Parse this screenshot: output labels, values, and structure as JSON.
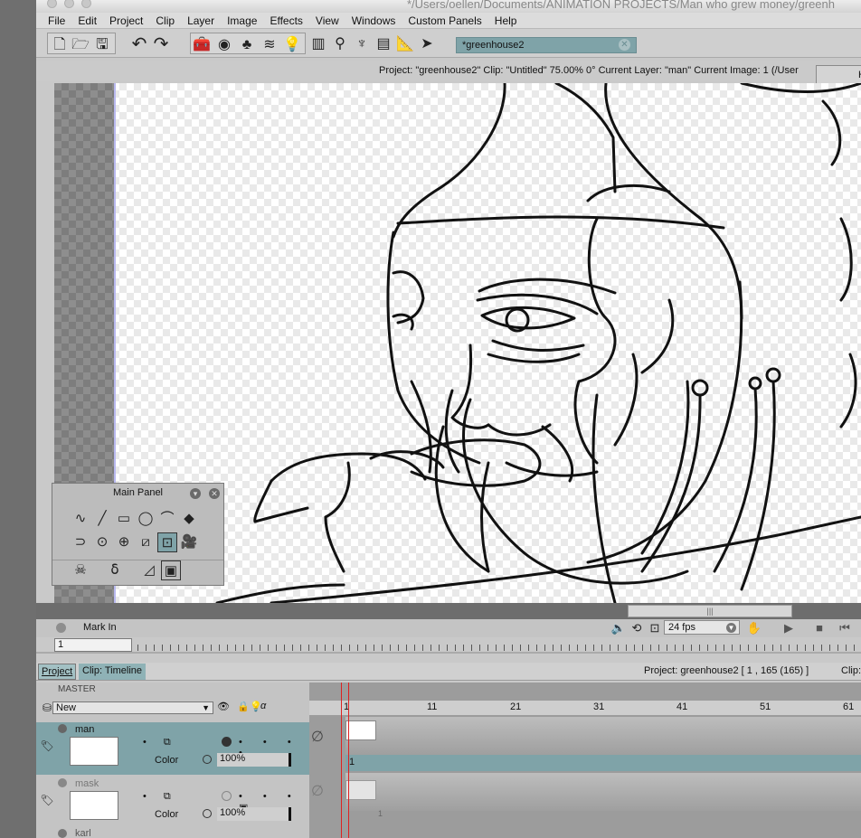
{
  "window": {
    "title": "*/Users/oellen/Documents/ANIMATION PROJECTS/Man who grew money/greenh"
  },
  "menu": [
    "File",
    "Edit",
    "Project",
    "Clip",
    "Layer",
    "Image",
    "Effects",
    "View",
    "Windows",
    "Custom Panels",
    "Help"
  ],
  "toolbar": {
    "search_value": "*greenhouse2",
    "icons": [
      "new-file-icon",
      "open-folder-icon",
      "save-icon",
      "undo-icon",
      "redo-icon",
      "toolbox-icon",
      "color-wheel-icon",
      "library-icon",
      "layers-icon",
      "lightbulb-icon",
      "film-strip-icon",
      "magnifier-icon",
      "brush-jar-icon",
      "bookshelf-icon",
      "ruler-icon",
      "paper-plane-icon"
    ]
  },
  "infobar": {
    "text": "Project:  \"greenhouse2\"  Clip: \"Untitled\"   75.00%   0°  Current Layer: \"man\"  Current Image: 1 (/User",
    "button": "H"
  },
  "main_panel": {
    "title": "Main Panel"
  },
  "transport": {
    "mark_in": "Mark In",
    "fps": "24 fps"
  },
  "frame_field": {
    "value": "1"
  },
  "panel_tabs": {
    "project": "Project",
    "clip": "Clip: Timeline",
    "info": "Project: greenhouse2 [ 1 , 165  (165) ]",
    "info_right": "Clip:"
  },
  "layers": {
    "master": "MASTER",
    "new_label": "New",
    "items": [
      {
        "name": "man",
        "color_label": "Color",
        "opacity": "100%",
        "selected": true
      },
      {
        "name": "mask",
        "color_label": "Color",
        "opacity": "100%",
        "selected": false
      },
      {
        "name": "karl",
        "selected": false
      }
    ]
  },
  "timeline": {
    "ticks": [
      "1",
      "11",
      "21",
      "31",
      "41",
      "51",
      "61"
    ],
    "frame_markers": [
      "1",
      "1"
    ]
  }
}
